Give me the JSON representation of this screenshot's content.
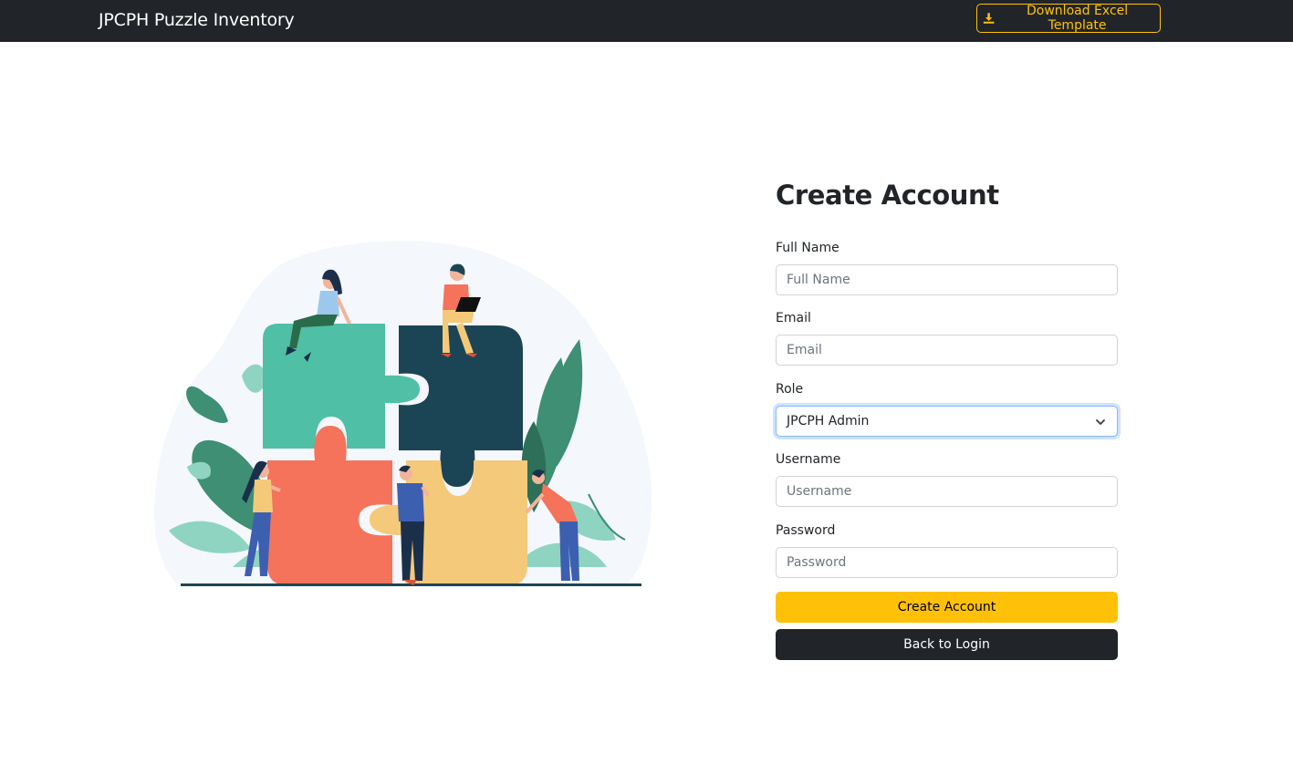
{
  "nav": {
    "brand": "JPCPH Puzzle Inventory",
    "download_label": "Download Excel Template",
    "download_icon": "download-icon"
  },
  "illustration": {
    "icon": "team-puzzle-illustration"
  },
  "form": {
    "title": "Create Account",
    "full_name": {
      "label": "Full Name",
      "placeholder": "Full Name",
      "value": ""
    },
    "email": {
      "label": "Email",
      "placeholder": "Email",
      "value": ""
    },
    "role": {
      "label": "Role",
      "selected": "JPCPH Admin"
    },
    "username": {
      "label": "Username",
      "placeholder": "Username",
      "value": ""
    },
    "password": {
      "label": "Password",
      "placeholder": "Password",
      "value": ""
    },
    "create_label": "Create Account",
    "back_label": "Back to Login"
  },
  "colors": {
    "navbar": "#212529",
    "accent": "#ffc107",
    "dark_button": "#212529",
    "puzzle_teal": "#4fbfa5",
    "puzzle_navy": "#1b4555",
    "puzzle_coral": "#f4735a",
    "puzzle_yellow": "#f5c97a"
  }
}
